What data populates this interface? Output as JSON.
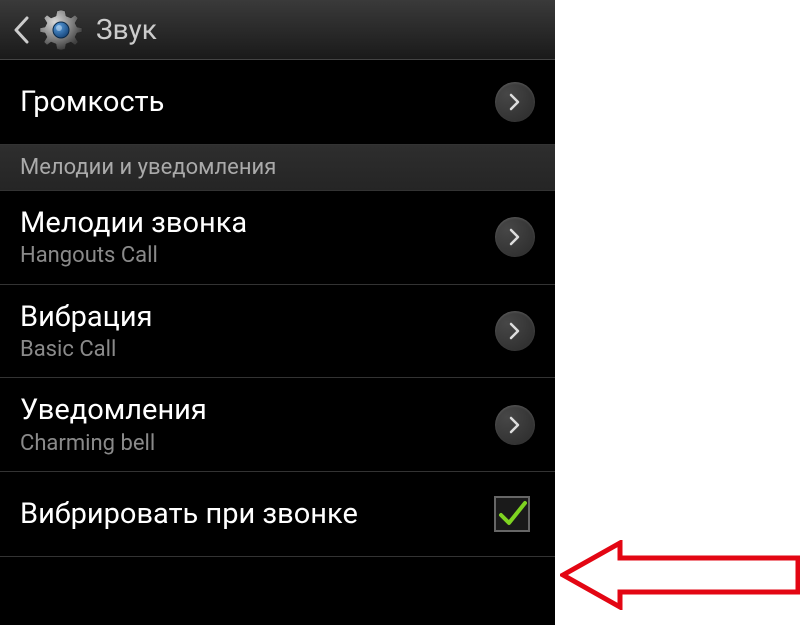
{
  "header": {
    "title": "Звук"
  },
  "items": {
    "volume": {
      "title": "Громкость"
    },
    "section_ringtones": {
      "label": "Мелодии и уведомления"
    },
    "ringtone": {
      "title": "Мелодии звонка",
      "subtitle": "Hangouts Call"
    },
    "vibration": {
      "title": "Вибрация",
      "subtitle": "Basic Call"
    },
    "notifications": {
      "title": "Уведомления",
      "subtitle": "Charming bell"
    },
    "vibrate_on_call": {
      "title": "Вибрировать при звонке",
      "checked": true
    }
  },
  "colors": {
    "checkmark": "#7ED321",
    "arrow_annotation": "#E30613"
  }
}
